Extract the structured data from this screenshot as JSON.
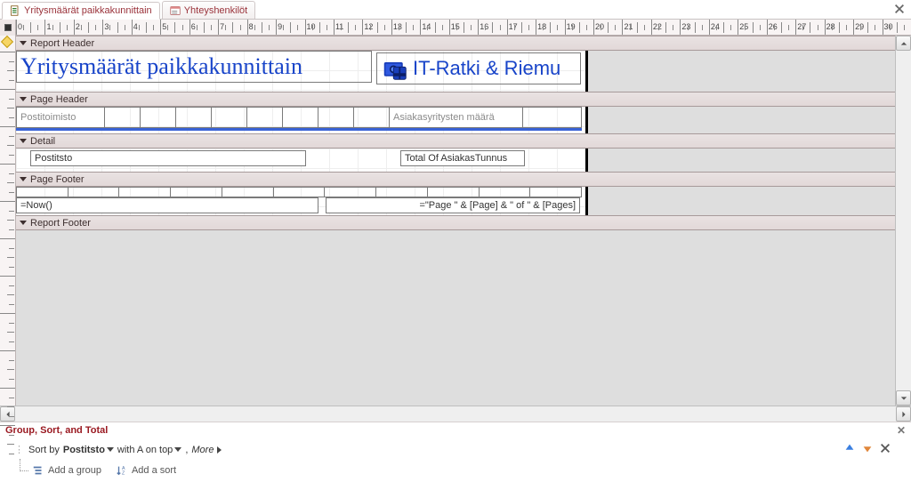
{
  "tabs": [
    {
      "label": "Yritysmäärät paikkakunnittain",
      "active": true,
      "kind": "report"
    },
    {
      "label": "Yhteyshenkilöt",
      "active": false,
      "kind": "form"
    }
  ],
  "close_label": "Close",
  "ruler_units_to": 31,
  "sections": {
    "report_header": {
      "label": "Report Header"
    },
    "page_header": {
      "label": "Page Header"
    },
    "detail": {
      "label": "Detail"
    },
    "page_footer": {
      "label": "Page Footer"
    },
    "report_footer": {
      "label": "Report Footer"
    }
  },
  "report_header_controls": {
    "title": "Yritysmäärät paikkakunnittain",
    "brand": "IT-Ratki & Riemu"
  },
  "page_header_controls": {
    "col1": "Postitoimisto",
    "col2": "Asiakasyritysten määrä"
  },
  "detail_controls": {
    "field1": "Postitsto",
    "field2": "Total Of AsiakasTunnus"
  },
  "page_footer_controls": {
    "now_expr": "=Now()",
    "page_expr": "=\"Page \" & [Page] & \" of \" & [Pages]"
  },
  "gst": {
    "title": "Group, Sort, and Total",
    "sort_by": "Sort by",
    "sort_field": "Postitsto",
    "order_text": "with A on top",
    "more": "More",
    "add_group": "Add a group",
    "add_sort": "Add a sort"
  }
}
